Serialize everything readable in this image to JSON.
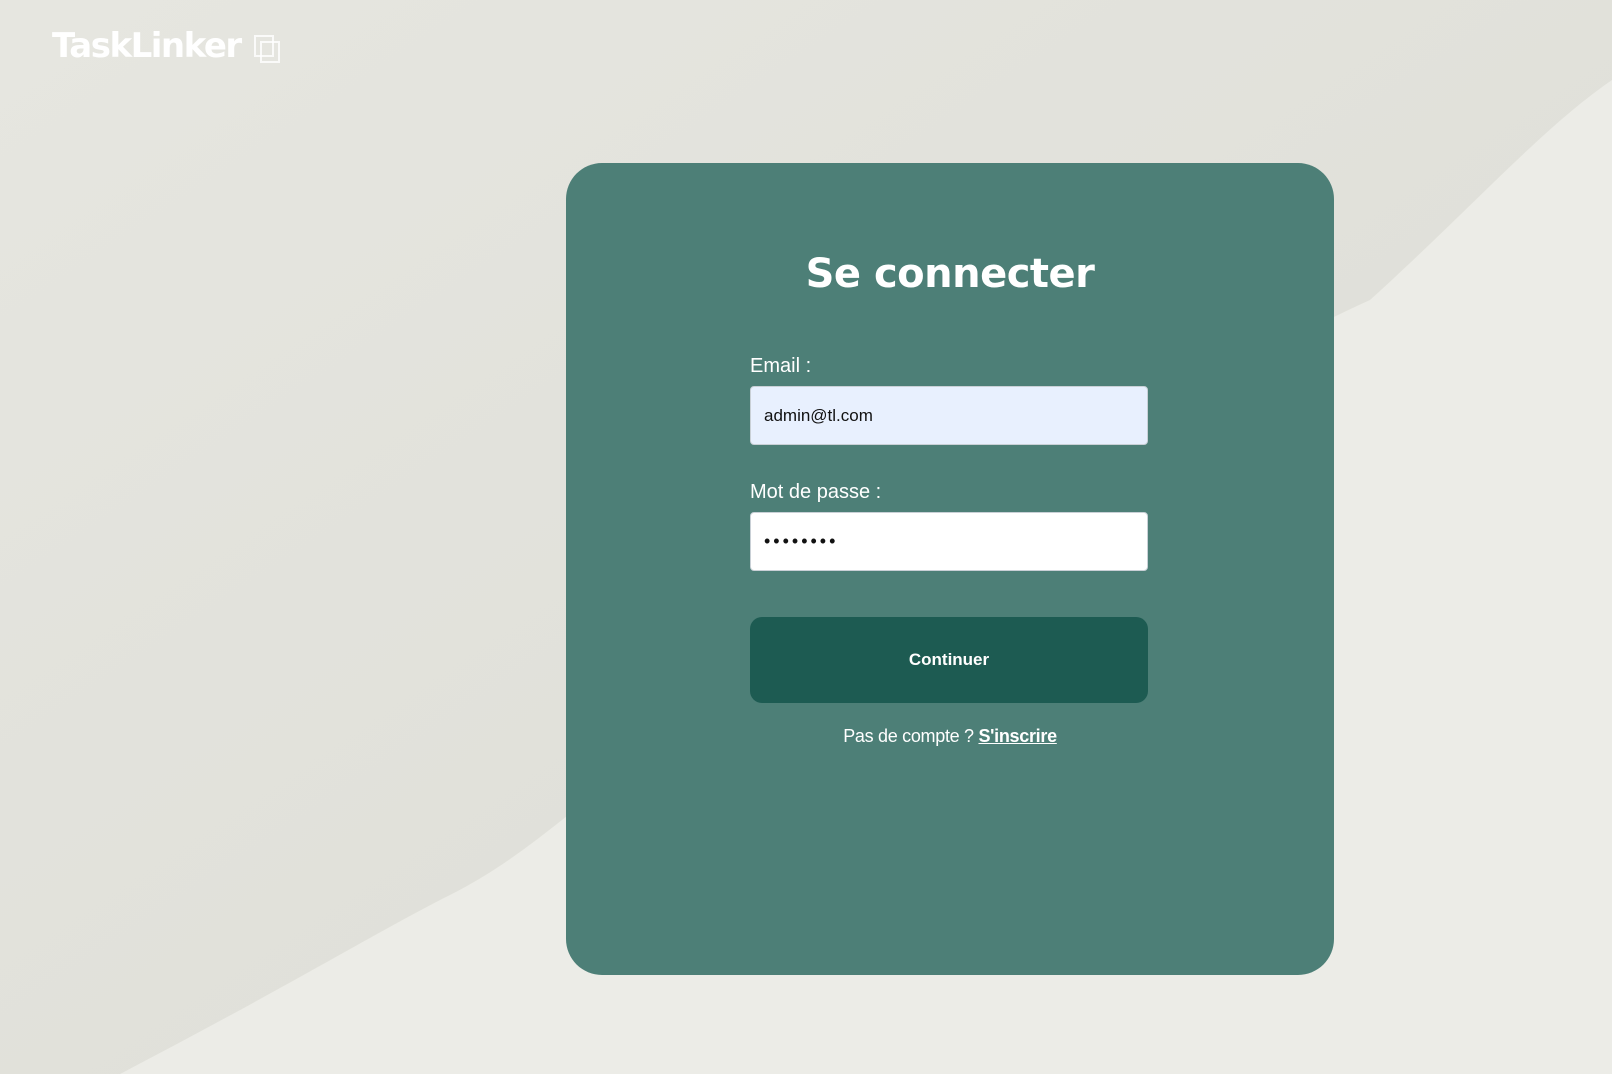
{
  "brand": {
    "name": "TaskLinker",
    "icon": "copy-squares-icon"
  },
  "login": {
    "title": "Se connecter",
    "email_label": "Email :",
    "email_value": "admin@tl.com",
    "password_label": "Mot de passe :",
    "password_value": "********",
    "submit_label": "Continuer",
    "no_account_text": "Pas de compte ? ",
    "signup_link": "S'inscrire"
  },
  "colors": {
    "page_background": "#e3e3dd",
    "card_background": "#4d7f77",
    "button_background": "#1d5b52",
    "email_autofill_background": "#e8f0fe"
  }
}
